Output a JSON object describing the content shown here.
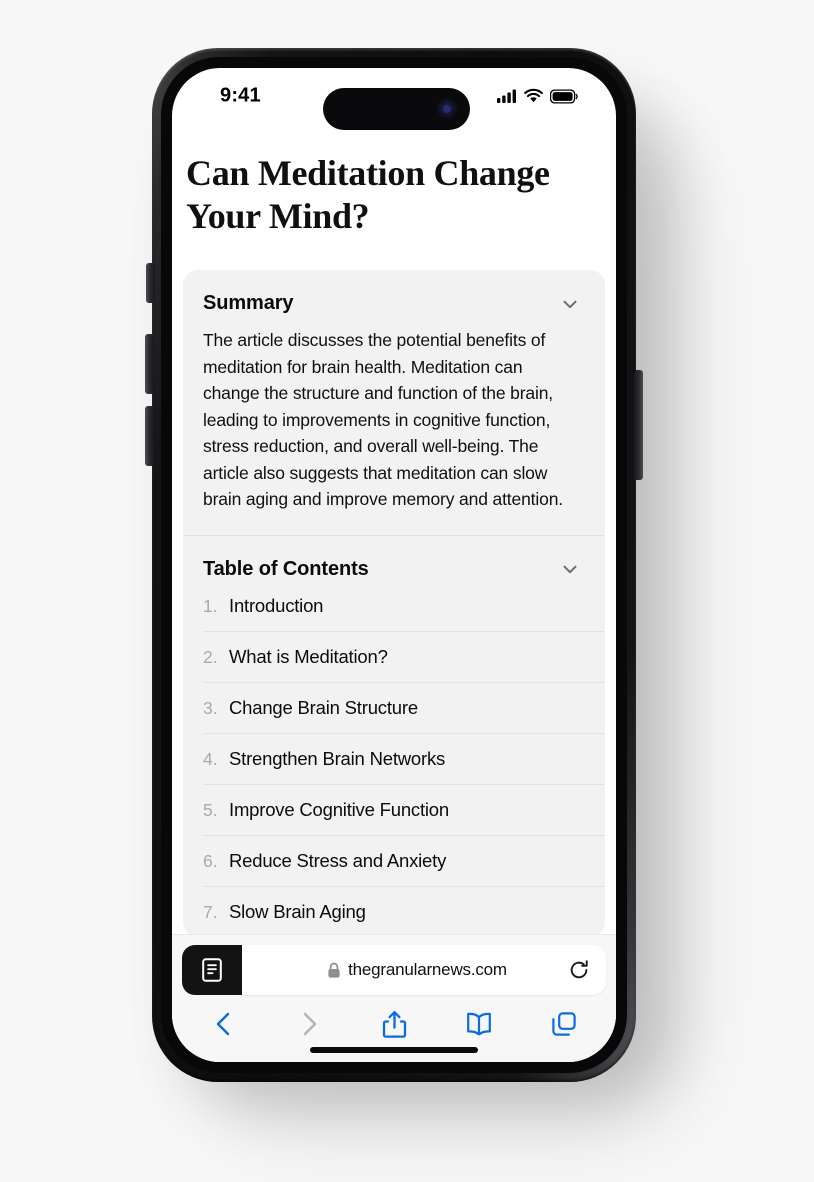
{
  "status_bar": {
    "time": "9:41",
    "signal_icon": "cellular-signal-icon",
    "wifi_icon": "wifi-icon",
    "battery_icon": "battery-full-icon"
  },
  "article": {
    "headline": "Can Meditation Change Your Mind?"
  },
  "summary": {
    "title": "Summary",
    "chevron_icon": "chevron-down-icon",
    "body": "The article discusses the potential benefits of meditation for brain health. Meditation can change the structure and function of the brain, leading to improvements in cognitive function, stress reduction, and overall well-being. The article also suggests that meditation can slow brain aging and improve memory and attention."
  },
  "table_of_contents": {
    "title": "Table of Contents",
    "chevron_icon": "chevron-down-icon",
    "items": [
      {
        "number": "1.",
        "label": "Introduction"
      },
      {
        "number": "2.",
        "label": "What is Meditation?"
      },
      {
        "number": "3.",
        "label": "Change Brain Structure"
      },
      {
        "number": "4.",
        "label": "Strengthen Brain Networks"
      },
      {
        "number": "5.",
        "label": "Improve Cognitive Function"
      },
      {
        "number": "6.",
        "label": "Reduce Stress and Anxiety"
      },
      {
        "number": "7.",
        "label": "Slow Brain Aging"
      }
    ]
  },
  "browser": {
    "reader_button_icon": "reader-mode-icon",
    "lock_icon": "lock-icon",
    "url": "thegranularnews.com",
    "reload_icon": "reload-icon",
    "toolbar": [
      {
        "name": "back-button",
        "icon": "chevron-left-icon",
        "enabled": true
      },
      {
        "name": "forward-button",
        "icon": "chevron-right-icon",
        "enabled": false
      },
      {
        "name": "share-button",
        "icon": "share-icon",
        "enabled": true
      },
      {
        "name": "bookmarks-button",
        "icon": "book-icon",
        "enabled": true
      },
      {
        "name": "tabs-button",
        "icon": "tabs-icon",
        "enabled": true
      }
    ]
  },
  "colors": {
    "accent_blue": "#0a6ce0",
    "disabled_gray": "#b3b3b8",
    "card_background": "#f2f2f3",
    "text_primary": "#0c0c0c",
    "number_gray": "#a9a9ad"
  },
  "device": {
    "home_indicator": "home-indicator"
  }
}
